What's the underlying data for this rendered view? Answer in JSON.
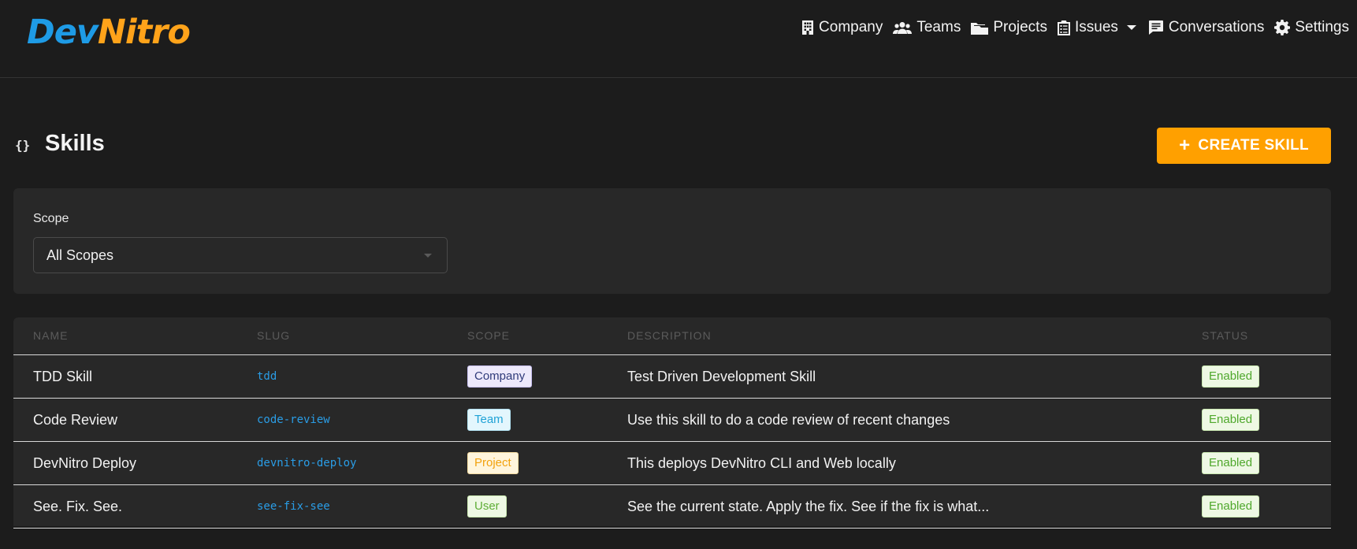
{
  "brand": {
    "part1": "Dev",
    "part2": "Nitro",
    "color1": "#1e9be6",
    "color2": "#ffa31a"
  },
  "nav": [
    {
      "label": "Company",
      "icon": "building-icon"
    },
    {
      "label": "Teams",
      "icon": "people-icon"
    },
    {
      "label": "Projects",
      "icon": "folders-icon"
    },
    {
      "label": "Issues",
      "icon": "clipboard-icon"
    },
    {
      "label": "Conversations",
      "icon": "chat-icon"
    },
    {
      "label": "Settings",
      "icon": "gear-icon"
    }
  ],
  "page": {
    "icon_text": "{}",
    "title": "Skills",
    "create_label": "CREATE SKILL",
    "accent": "#ffa000"
  },
  "filter": {
    "label": "Scope",
    "value": "All Scopes"
  },
  "table": {
    "headers": [
      "NAME",
      "SLUG",
      "SCOPE",
      "DESCRIPTION",
      "STATUS"
    ],
    "rows": [
      {
        "name": "TDD Skill",
        "slug": "tdd",
        "scope": "Company",
        "description": "Test Driven Development Skill",
        "status": "Enabled"
      },
      {
        "name": "Code Review",
        "slug": "code-review",
        "scope": "Team",
        "description": "Use this skill to do a code review of recent changes",
        "status": "Enabled"
      },
      {
        "name": "DevNitro Deploy",
        "slug": "devnitro-deploy",
        "scope": "Project",
        "description": "This deploys DevNitro CLI and Web locally",
        "status": "Enabled"
      },
      {
        "name": "See. Fix. See.",
        "slug": "see-fix-see",
        "scope": "User",
        "description": "See the current state. Apply the fix. See if the fix is what...",
        "status": "Enabled"
      }
    ]
  }
}
